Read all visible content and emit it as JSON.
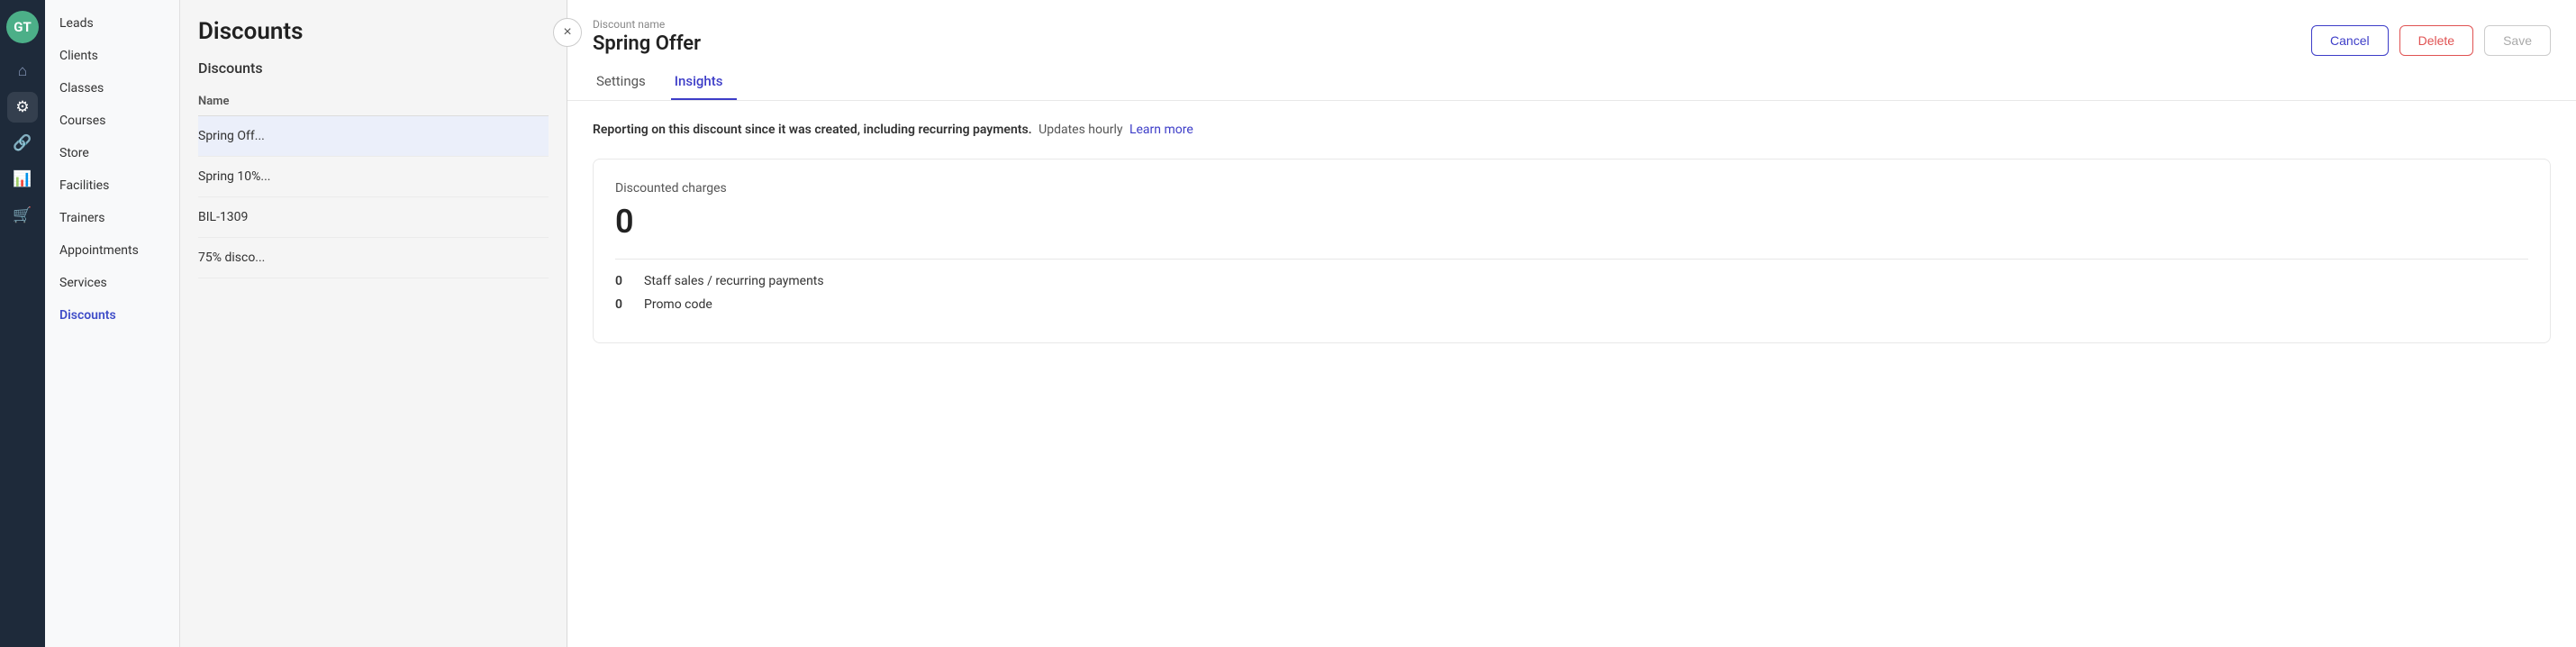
{
  "app": {
    "logo_text": "GT"
  },
  "sidebar": {
    "icons": [
      {
        "name": "home-icon",
        "symbol": "⌂",
        "active": false
      },
      {
        "name": "tools-icon",
        "symbol": "🔧",
        "active": true
      },
      {
        "name": "link-icon",
        "symbol": "🔗",
        "active": false
      },
      {
        "name": "chart-icon",
        "symbol": "📊",
        "active": false
      },
      {
        "name": "cart-icon",
        "symbol": "🛒",
        "active": false
      }
    ],
    "nav_items": [
      {
        "label": "Leads",
        "active": false
      },
      {
        "label": "Clients",
        "active": false
      },
      {
        "label": "Classes",
        "active": false
      },
      {
        "label": "Courses",
        "active": false
      },
      {
        "label": "Store",
        "active": false
      },
      {
        "label": "Facilities",
        "active": false
      },
      {
        "label": "Trainers",
        "active": false
      },
      {
        "label": "Appointments",
        "active": false
      },
      {
        "label": "Services",
        "active": false
      },
      {
        "label": "Discounts",
        "active": true
      }
    ]
  },
  "discounts_panel": {
    "title": "Discounts",
    "subtitle": "Discounts",
    "table_header": "Name",
    "items": [
      {
        "label": "Spring Off..."
      },
      {
        "label": "Spring 10%..."
      },
      {
        "label": "BIL-1309"
      },
      {
        "label": "75% disco..."
      }
    ]
  },
  "modal": {
    "discount_name_label": "Discount name",
    "title": "Spring Offer",
    "close_label": "×",
    "tabs": [
      {
        "label": "Settings",
        "active": false
      },
      {
        "label": "Insights",
        "active": true
      }
    ],
    "buttons": {
      "cancel": "Cancel",
      "delete": "Delete",
      "save": "Save"
    },
    "reporting_text_bold": "Reporting on this discount since it was created, including recurring payments.",
    "reporting_text_normal": " Updates hourly",
    "learn_more": "Learn more",
    "card": {
      "label": "Discounted charges",
      "value": "0",
      "rows": [
        {
          "value": "0",
          "label": "Staff sales / recurring payments"
        },
        {
          "value": "0",
          "label": "Promo code"
        }
      ]
    }
  }
}
